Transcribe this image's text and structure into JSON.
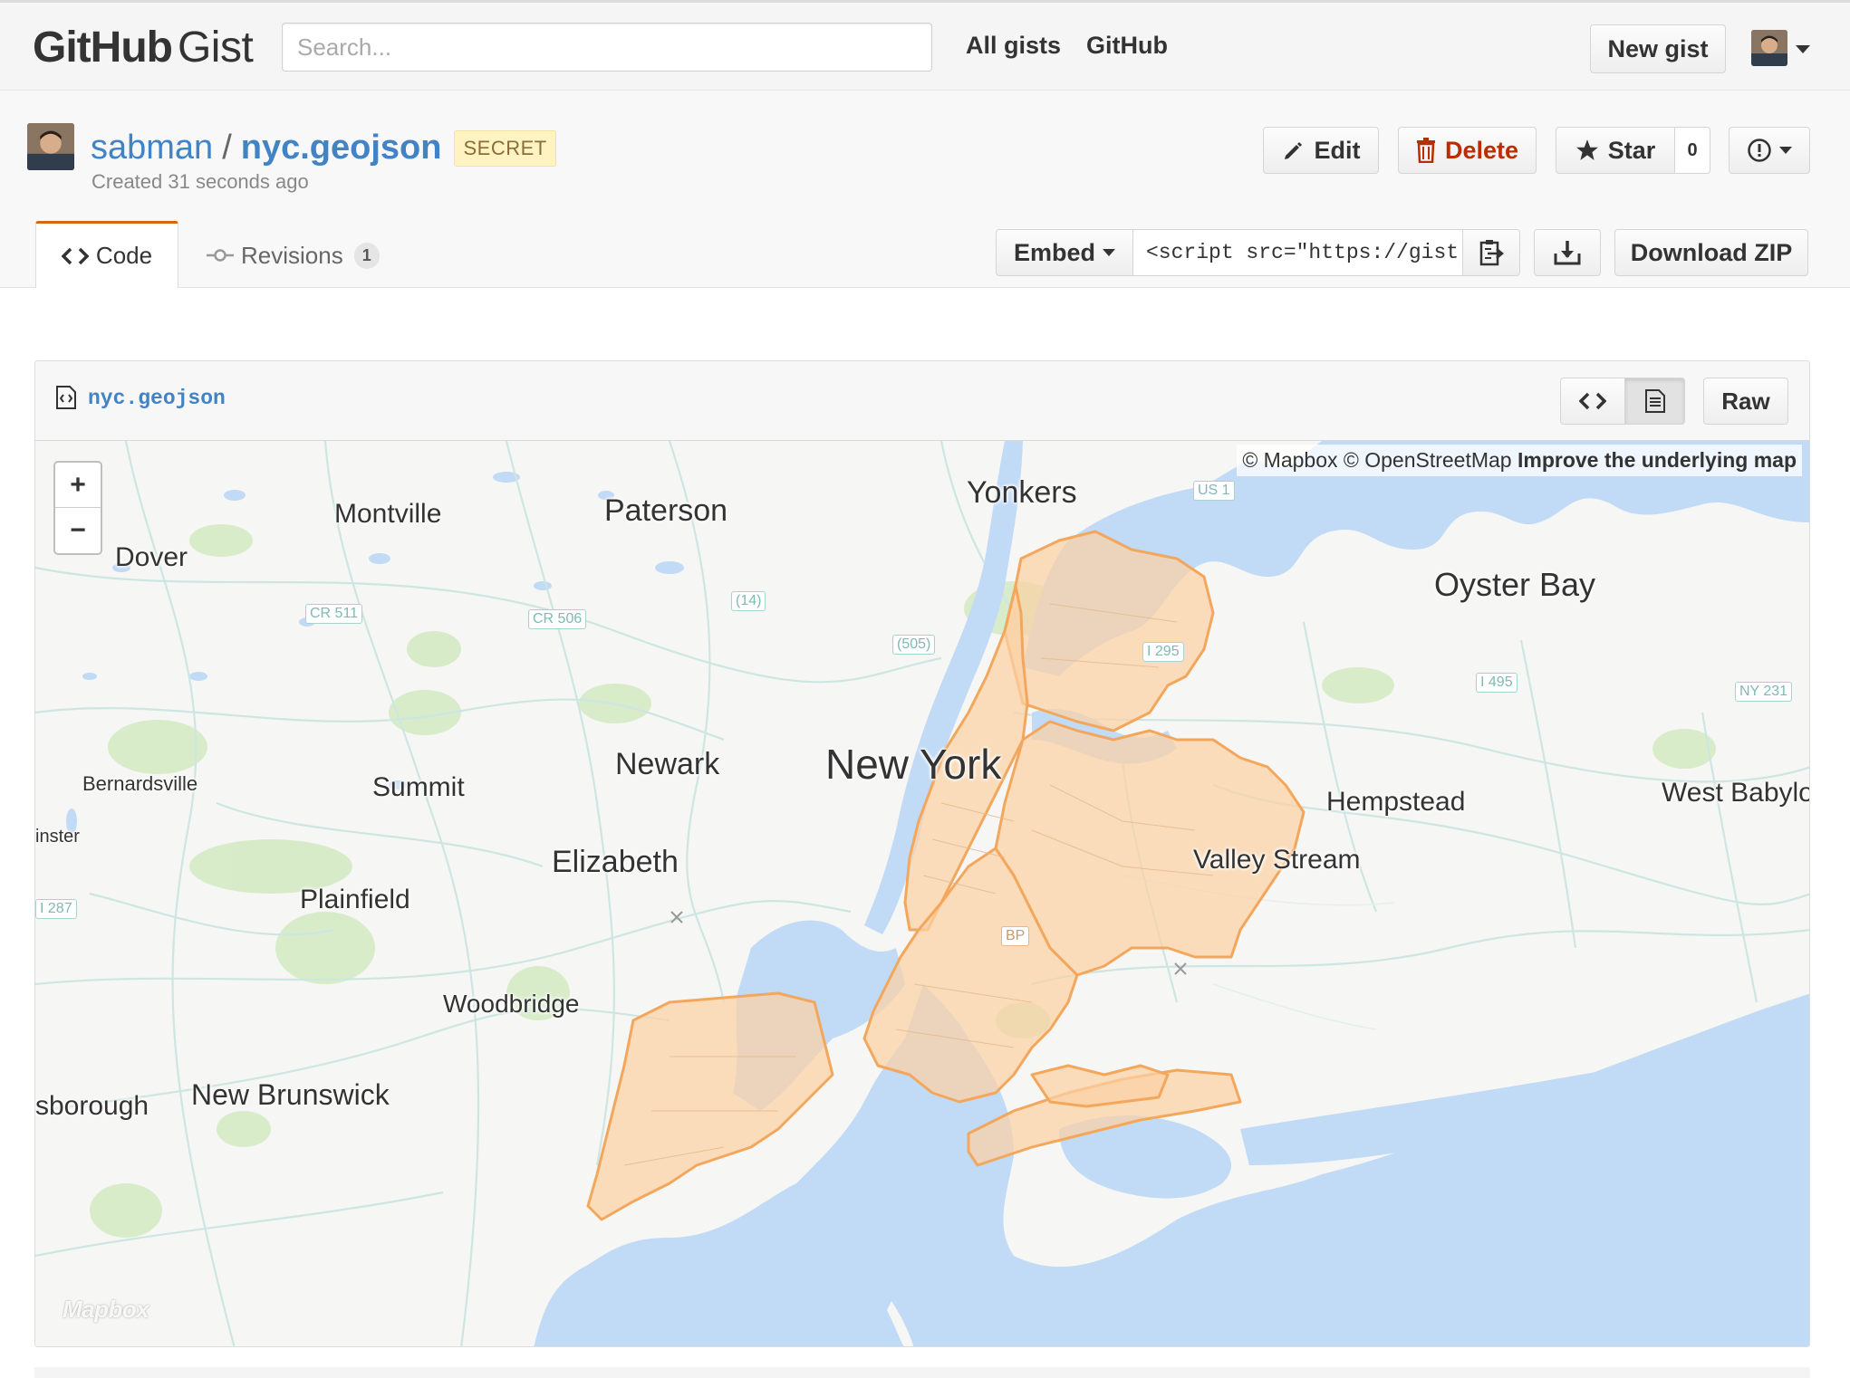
{
  "header": {
    "logo_github": "GitHub",
    "logo_gist": "Gist",
    "search_placeholder": "Search...",
    "nav_all_gists": "All gists",
    "nav_github": "GitHub",
    "new_gist": "New gist"
  },
  "gist": {
    "owner": "sabman",
    "separator": "/",
    "name": "nyc.geojson",
    "visibility": "SECRET",
    "created": "Created 31 seconds ago",
    "actions": {
      "edit": "Edit",
      "delete": "Delete",
      "star": "Star",
      "star_count": "0"
    }
  },
  "tabs": {
    "code": "Code",
    "revisions": "Revisions",
    "revisions_count": "1"
  },
  "embed": {
    "label": "Embed",
    "value": "<script src=\"https://gist",
    "download_zip": "Download ZIP"
  },
  "file": {
    "name": "nyc.geojson",
    "raw": "Raw"
  },
  "map": {
    "attribution_1": "© Mapbox",
    "attribution_2": "© OpenStreetMap",
    "attribution_link": "Improve the underlying map",
    "zoom_in": "+",
    "zoom_out": "−",
    "logo": "Mapbox",
    "places": {
      "yonkers": "Yonkers",
      "paterson": "Paterson",
      "montville": "Montville",
      "dover": "Dover",
      "oyster_bay": "Oyster Bay",
      "newark": "Newark",
      "new_york": "New York",
      "bernardsville": "Bernardsville",
      "summit": "Summit",
      "hempstead": "Hempstead",
      "west_babylon": "West Babylo",
      "westminster": "inster",
      "elizabeth": "Elizabeth",
      "valley_stream": "Valley Stream",
      "plainfield": "Plainfield",
      "woodbridge": "Woodbridge",
      "new_brunswick": "New Brunswick",
      "sborough": "sborough"
    },
    "shields": {
      "us1": "US 1",
      "cr511": "CR 511",
      "cr506": "CR 506",
      "r14": "(14)",
      "r505": "(505)",
      "i295": "I 295",
      "i495": "I 495",
      "ny231": "NY 231",
      "i287": "I 287",
      "bp": "BP"
    },
    "colors": {
      "water": "#c1daf5",
      "land": "#f6f6f4",
      "park": "#d6ebc7",
      "road": "#c7e3df",
      "overlay_fill": "#fbd1a5",
      "overlay_stroke": "#f3a75c"
    }
  },
  "colors": {
    "link": "#4183c4",
    "delete": "#bd2c00",
    "tab_accent": "#d26911",
    "secret_bg": "#fff3c2"
  }
}
